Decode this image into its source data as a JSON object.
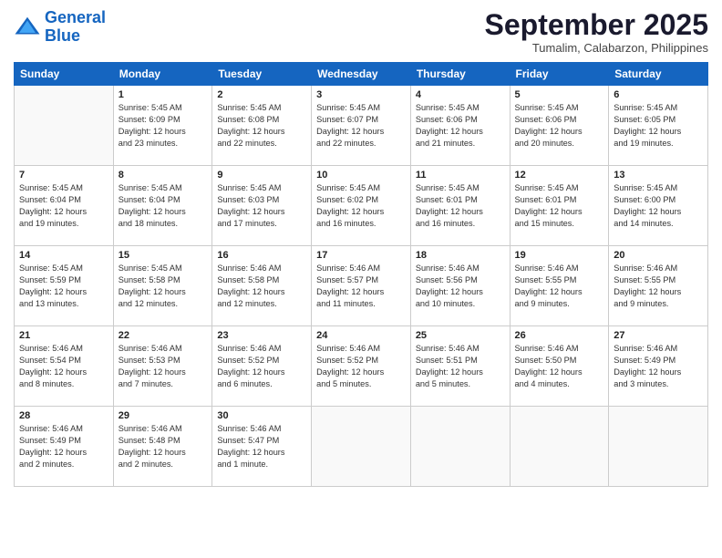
{
  "logo": {
    "line1": "General",
    "line2": "Blue"
  },
  "title": "September 2025",
  "location": "Tumalim, Calabarzon, Philippines",
  "days_of_week": [
    "Sunday",
    "Monday",
    "Tuesday",
    "Wednesday",
    "Thursday",
    "Friday",
    "Saturday"
  ],
  "weeks": [
    [
      {
        "day": "",
        "info": ""
      },
      {
        "day": "1",
        "info": "Sunrise: 5:45 AM\nSunset: 6:09 PM\nDaylight: 12 hours\nand 23 minutes."
      },
      {
        "day": "2",
        "info": "Sunrise: 5:45 AM\nSunset: 6:08 PM\nDaylight: 12 hours\nand 22 minutes."
      },
      {
        "day": "3",
        "info": "Sunrise: 5:45 AM\nSunset: 6:07 PM\nDaylight: 12 hours\nand 22 minutes."
      },
      {
        "day": "4",
        "info": "Sunrise: 5:45 AM\nSunset: 6:06 PM\nDaylight: 12 hours\nand 21 minutes."
      },
      {
        "day": "5",
        "info": "Sunrise: 5:45 AM\nSunset: 6:06 PM\nDaylight: 12 hours\nand 20 minutes."
      },
      {
        "day": "6",
        "info": "Sunrise: 5:45 AM\nSunset: 6:05 PM\nDaylight: 12 hours\nand 19 minutes."
      }
    ],
    [
      {
        "day": "7",
        "info": "Sunrise: 5:45 AM\nSunset: 6:04 PM\nDaylight: 12 hours\nand 19 minutes."
      },
      {
        "day": "8",
        "info": "Sunrise: 5:45 AM\nSunset: 6:04 PM\nDaylight: 12 hours\nand 18 minutes."
      },
      {
        "day": "9",
        "info": "Sunrise: 5:45 AM\nSunset: 6:03 PM\nDaylight: 12 hours\nand 17 minutes."
      },
      {
        "day": "10",
        "info": "Sunrise: 5:45 AM\nSunset: 6:02 PM\nDaylight: 12 hours\nand 16 minutes."
      },
      {
        "day": "11",
        "info": "Sunrise: 5:45 AM\nSunset: 6:01 PM\nDaylight: 12 hours\nand 16 minutes."
      },
      {
        "day": "12",
        "info": "Sunrise: 5:45 AM\nSunset: 6:01 PM\nDaylight: 12 hours\nand 15 minutes."
      },
      {
        "day": "13",
        "info": "Sunrise: 5:45 AM\nSunset: 6:00 PM\nDaylight: 12 hours\nand 14 minutes."
      }
    ],
    [
      {
        "day": "14",
        "info": "Sunrise: 5:45 AM\nSunset: 5:59 PM\nDaylight: 12 hours\nand 13 minutes."
      },
      {
        "day": "15",
        "info": "Sunrise: 5:45 AM\nSunset: 5:58 PM\nDaylight: 12 hours\nand 12 minutes."
      },
      {
        "day": "16",
        "info": "Sunrise: 5:46 AM\nSunset: 5:58 PM\nDaylight: 12 hours\nand 12 minutes."
      },
      {
        "day": "17",
        "info": "Sunrise: 5:46 AM\nSunset: 5:57 PM\nDaylight: 12 hours\nand 11 minutes."
      },
      {
        "day": "18",
        "info": "Sunrise: 5:46 AM\nSunset: 5:56 PM\nDaylight: 12 hours\nand 10 minutes."
      },
      {
        "day": "19",
        "info": "Sunrise: 5:46 AM\nSunset: 5:55 PM\nDaylight: 12 hours\nand 9 minutes."
      },
      {
        "day": "20",
        "info": "Sunrise: 5:46 AM\nSunset: 5:55 PM\nDaylight: 12 hours\nand 9 minutes."
      }
    ],
    [
      {
        "day": "21",
        "info": "Sunrise: 5:46 AM\nSunset: 5:54 PM\nDaylight: 12 hours\nand 8 minutes."
      },
      {
        "day": "22",
        "info": "Sunrise: 5:46 AM\nSunset: 5:53 PM\nDaylight: 12 hours\nand 7 minutes."
      },
      {
        "day": "23",
        "info": "Sunrise: 5:46 AM\nSunset: 5:52 PM\nDaylight: 12 hours\nand 6 minutes."
      },
      {
        "day": "24",
        "info": "Sunrise: 5:46 AM\nSunset: 5:52 PM\nDaylight: 12 hours\nand 5 minutes."
      },
      {
        "day": "25",
        "info": "Sunrise: 5:46 AM\nSunset: 5:51 PM\nDaylight: 12 hours\nand 5 minutes."
      },
      {
        "day": "26",
        "info": "Sunrise: 5:46 AM\nSunset: 5:50 PM\nDaylight: 12 hours\nand 4 minutes."
      },
      {
        "day": "27",
        "info": "Sunrise: 5:46 AM\nSunset: 5:49 PM\nDaylight: 12 hours\nand 3 minutes."
      }
    ],
    [
      {
        "day": "28",
        "info": "Sunrise: 5:46 AM\nSunset: 5:49 PM\nDaylight: 12 hours\nand 2 minutes."
      },
      {
        "day": "29",
        "info": "Sunrise: 5:46 AM\nSunset: 5:48 PM\nDaylight: 12 hours\nand 2 minutes."
      },
      {
        "day": "30",
        "info": "Sunrise: 5:46 AM\nSunset: 5:47 PM\nDaylight: 12 hours\nand 1 minute."
      },
      {
        "day": "",
        "info": ""
      },
      {
        "day": "",
        "info": ""
      },
      {
        "day": "",
        "info": ""
      },
      {
        "day": "",
        "info": ""
      }
    ]
  ]
}
